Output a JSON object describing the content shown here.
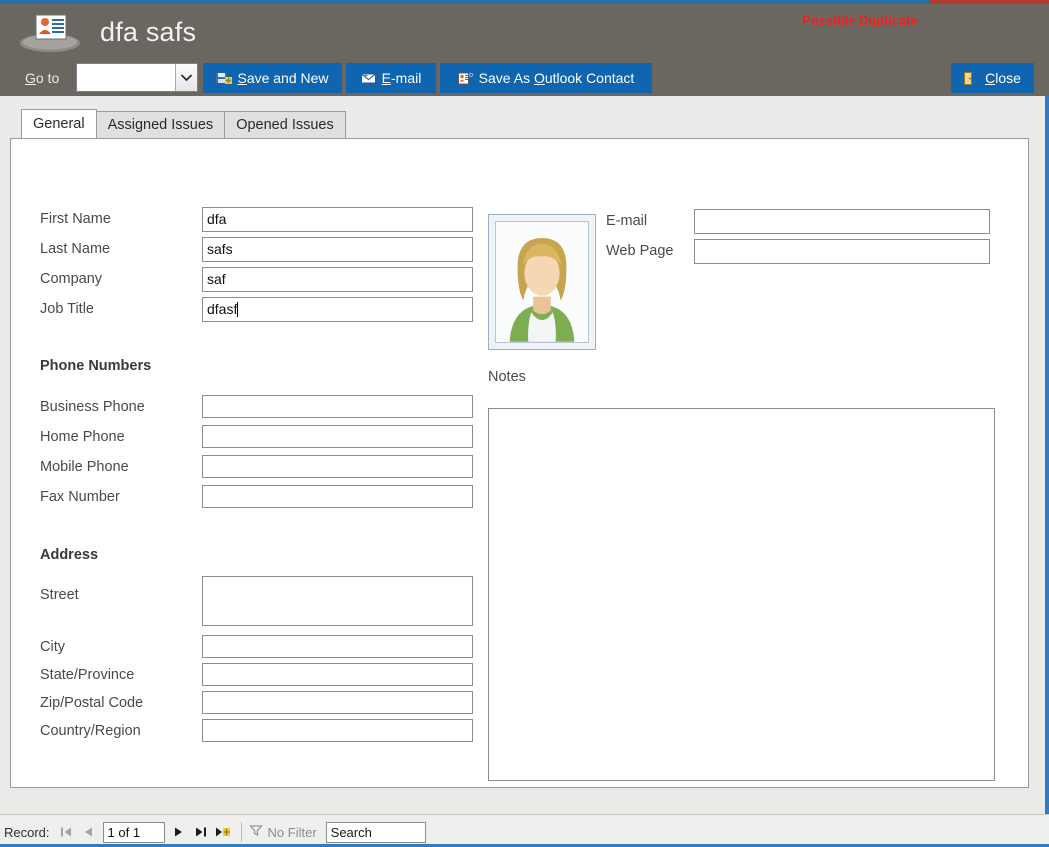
{
  "window": {
    "title": "dfa safs",
    "title_icon": "contact-card-icon",
    "accent_color": "#2e7cc4",
    "header_bg": "#6a6761",
    "button_color": "#1065b0"
  },
  "header": {
    "duplicate_warning": "Possible Duplicate",
    "duplicate_warning_color": "#ef2020"
  },
  "toolbar": {
    "goto_label": "Go to",
    "goto_accesskey": "G",
    "goto_value": "",
    "goto_icon": "chevron-down-icon",
    "buttons": [
      {
        "label": "Save and New",
        "accesskey": "S",
        "icon": "save-new-icon"
      },
      {
        "label": "E-mail",
        "accesskey": "E",
        "icon": "envelope-icon"
      },
      {
        "label": "Save As Outlook Contact",
        "accesskey": "O",
        "icon": "outlook-contact-icon"
      }
    ],
    "close": {
      "label": "Close",
      "accesskey": "C",
      "icon": "exit-door-icon"
    }
  },
  "tabs": [
    {
      "label": "General",
      "active": true
    },
    {
      "label": "Assigned Issues",
      "active": false
    },
    {
      "label": "Opened Issues",
      "active": false
    }
  ],
  "form": {
    "identity_fields": [
      {
        "label": "First Name",
        "value": "dfa",
        "focused": false
      },
      {
        "label": "Last Name",
        "value": "safs",
        "focused": false
      },
      {
        "label": "Company",
        "value": "saf",
        "focused": false
      },
      {
        "label": "Job Title",
        "value": "dfasf",
        "focused": true
      }
    ],
    "phone_section": {
      "heading": "Phone Numbers",
      "fields": [
        {
          "label": "Business Phone",
          "value": ""
        },
        {
          "label": "Home Phone",
          "value": ""
        },
        {
          "label": "Mobile Phone",
          "value": ""
        },
        {
          "label": "Fax Number",
          "value": ""
        }
      ]
    },
    "address_section": {
      "heading": "Address",
      "fields": [
        {
          "label": "Street",
          "value": ""
        },
        {
          "label": "City",
          "value": ""
        },
        {
          "label": "State/Province",
          "value": ""
        },
        {
          "label": "Zip/Postal Code",
          "value": ""
        },
        {
          "label": "Country/Region",
          "value": ""
        }
      ]
    },
    "picture": {
      "alt": "contact-photo",
      "icon": "person-photo-icon"
    },
    "contact_fields": [
      {
        "label": "E-mail",
        "value": ""
      },
      {
        "label": "Web Page",
        "value": ""
      }
    ],
    "notes": {
      "label": "Notes",
      "value": ""
    }
  },
  "statusbar": {
    "record_label": "Record:",
    "position": "1 of 1",
    "first_icon": "go-first-icon",
    "prev_icon": "go-previous-icon",
    "next_icon": "go-next-icon",
    "last_icon": "go-last-icon",
    "new_icon": "new-record-icon",
    "filter_icon": "filter-icon",
    "filter_label": "No Filter",
    "search_value": "Search"
  }
}
